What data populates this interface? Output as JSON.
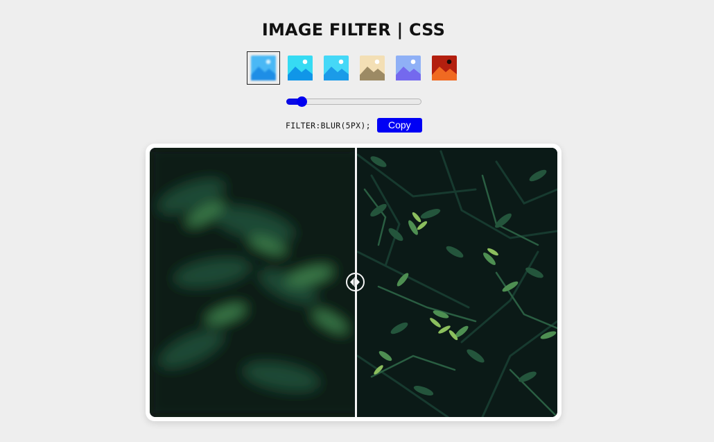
{
  "title": "IMAGE FILTER | CSS",
  "filters": {
    "presets": [
      {
        "name": "blur",
        "active": true,
        "sky": "#4ab8f5",
        "mountain": "#1e8ee6",
        "sun": "#d8f2ff"
      },
      {
        "name": "preset-2",
        "active": false,
        "sky": "#36dbf3",
        "mountain": "#1096e8",
        "sun": "#ffffff"
      },
      {
        "name": "preset-3",
        "active": false,
        "sky": "#45d8f7",
        "mountain": "#1b9be8",
        "sun": "#ffffff"
      },
      {
        "name": "preset-4",
        "active": false,
        "sky": "#f3dfb5",
        "mountain": "#9c8a64",
        "sun": "#ffffff"
      },
      {
        "name": "preset-5",
        "active": false,
        "sky": "#8fb0f6",
        "mountain": "#7469ee",
        "sun": "#ffffff"
      },
      {
        "name": "preset-6",
        "active": false,
        "sky": "#b31f0f",
        "mountain": "#f06a22",
        "sun": "#1a0b08"
      }
    ]
  },
  "slider": {
    "value_fraction": 0.08,
    "accent": "#0000f0"
  },
  "code": {
    "text": "FILTER:BLUR(5PX);",
    "copy_label": "Copy"
  },
  "compare": {
    "split_fraction": 0.505
  },
  "colors": {
    "accent": "#0000f5",
    "background": "#eeeeee"
  }
}
